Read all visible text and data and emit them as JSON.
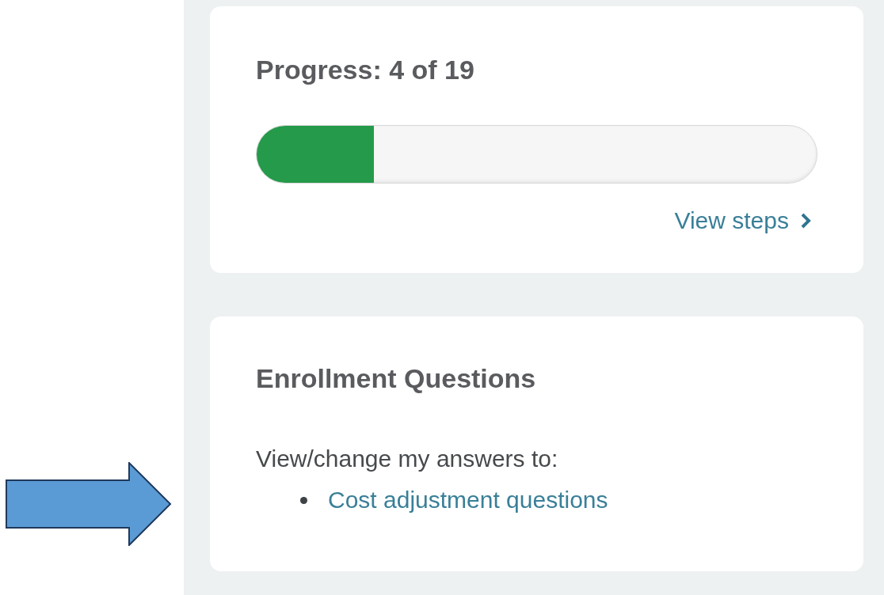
{
  "progress_card": {
    "title": "Progress: 4 of 19",
    "level": 0.21,
    "link": "View steps"
  },
  "enrollment_card": {
    "title": "Enrollment Questions",
    "intro": "View/change my answers to:",
    "links": [
      "Cost adjustment questions"
    ]
  }
}
